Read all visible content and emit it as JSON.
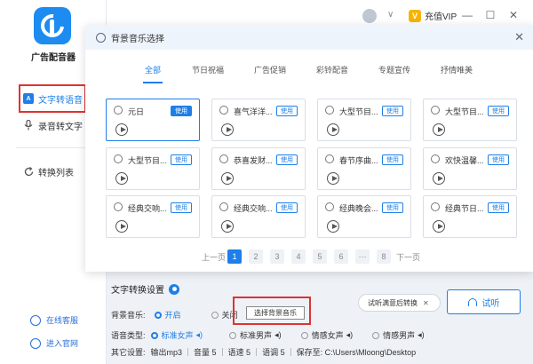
{
  "app": {
    "name": "广告配音器"
  },
  "sidebar": {
    "items": [
      {
        "label": "文字转语音",
        "icon": "A"
      },
      {
        "label": "录音转文字"
      },
      {
        "label": "转换列表"
      }
    ],
    "bottom": [
      {
        "label": "在线客服"
      },
      {
        "label": "进入官网"
      }
    ]
  },
  "topbar": {
    "vip_label": "充值VIP",
    "vip_badge": "V",
    "minimize": "—",
    "maximize": "☐",
    "close": "✕",
    "dropdown": "∨"
  },
  "modal": {
    "title": "背景音乐选择",
    "close": "✕",
    "tabs": [
      "全部",
      "节日祝福",
      "广告促销",
      "彩铃配音",
      "专题宣传",
      "抒情唯美"
    ],
    "use_label": "使用",
    "cards": [
      {
        "title": "元日"
      },
      {
        "title": "喜气洋洋..."
      },
      {
        "title": "大型节目..."
      },
      {
        "title": "大型节目..."
      },
      {
        "title": "大型节目..."
      },
      {
        "title": "恭喜发财..."
      },
      {
        "title": "春节序曲..."
      },
      {
        "title": "欢快温馨..."
      },
      {
        "title": "经典交响..."
      },
      {
        "title": "经典交响..."
      },
      {
        "title": "经典晚会..."
      },
      {
        "title": "经典节日..."
      }
    ],
    "pager": {
      "prev": "上一页",
      "next": "下一页",
      "pages": [
        "1",
        "2",
        "3",
        "4",
        "5",
        "6",
        "···",
        "8"
      ],
      "current": "1"
    }
  },
  "settings": {
    "title": "文字转换设置",
    "bgm_label": "背景音乐:",
    "bgm_on": "开启",
    "bgm_off": "关闭",
    "choose_button": "选择背景音乐",
    "voice_label": "语音类型:",
    "voices": [
      "标准女声",
      "标准男声",
      "情感女声",
      "情感男声"
    ],
    "other_label": "其它设置:",
    "output": "输出mp3",
    "volume": "音量 5",
    "speed": "语速 5",
    "pitch": "语调 5",
    "save_to": "保存至: C:\\Users\\Mloong\\Desktop"
  },
  "hint": {
    "text": "试听满意后转换",
    "close": "✕"
  },
  "listen_button": "试听"
}
